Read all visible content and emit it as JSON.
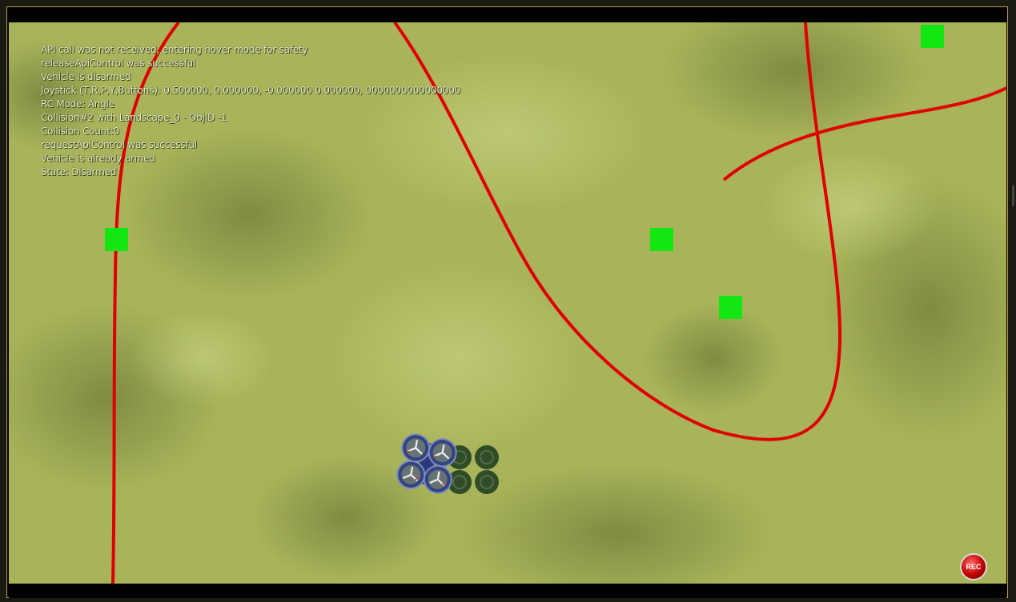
{
  "window": {
    "title": ""
  },
  "log": {
    "lines": [
      "API call was not received, entering hover mode for safety",
      "releaseApiControl was successful",
      "Vehicle is disarmed",
      "Joystick (T,R,P,Y,Buttons): 0.500000, 0.000000, -0.000000 0.000000, 0000000000000000",
      "RC Mode: Angle",
      "Collision#2 with Landscape_0 - ObjID -1",
      "Collision Count:0",
      "requestApiControl was successful",
      "Vehicle is already armed",
      "State: Disarmed"
    ]
  },
  "record_button": {
    "label": "REC"
  },
  "colors": {
    "trajectory": "#e00000",
    "waypoint": "#14e614",
    "terrain": "#a9b45a",
    "frame_border": "#b79a3a"
  },
  "icons": {
    "vehicle": "quadcopter-icon",
    "shadow": "quadcopter-shadow-icon",
    "record": "record-icon"
  }
}
